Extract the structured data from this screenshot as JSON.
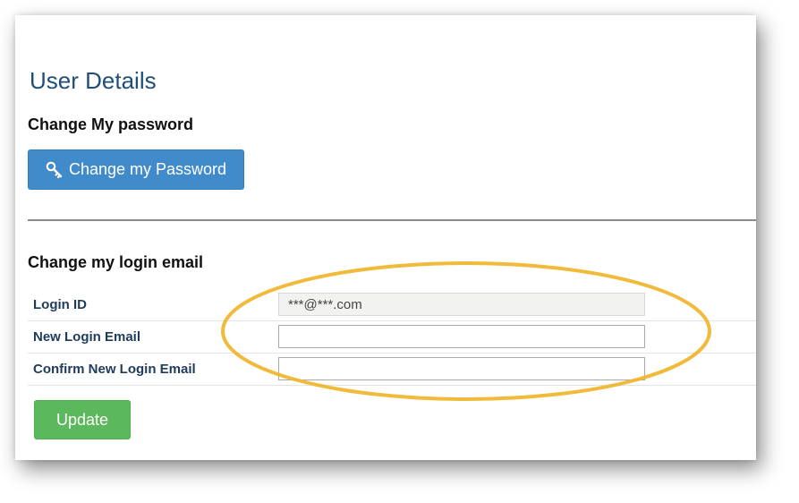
{
  "page": {
    "title": "User Details"
  },
  "password_section": {
    "heading": "Change My password",
    "button_label": "Change my Password",
    "button_icon": "key-icon",
    "button_color": "#428bca"
  },
  "email_section": {
    "heading": "Change my login email",
    "fields": [
      {
        "label": "Login ID",
        "value": "***@***.com",
        "placeholder": "",
        "readonly": true
      },
      {
        "label": "New Login Email",
        "value": "",
        "placeholder": "",
        "readonly": false
      },
      {
        "label": "Confirm New Login Email",
        "value": "",
        "placeholder": "",
        "readonly": false
      }
    ],
    "update_label": "Update",
    "update_color": "#5cb85c"
  },
  "annotation": {
    "highlight_color": "#f0b429"
  }
}
